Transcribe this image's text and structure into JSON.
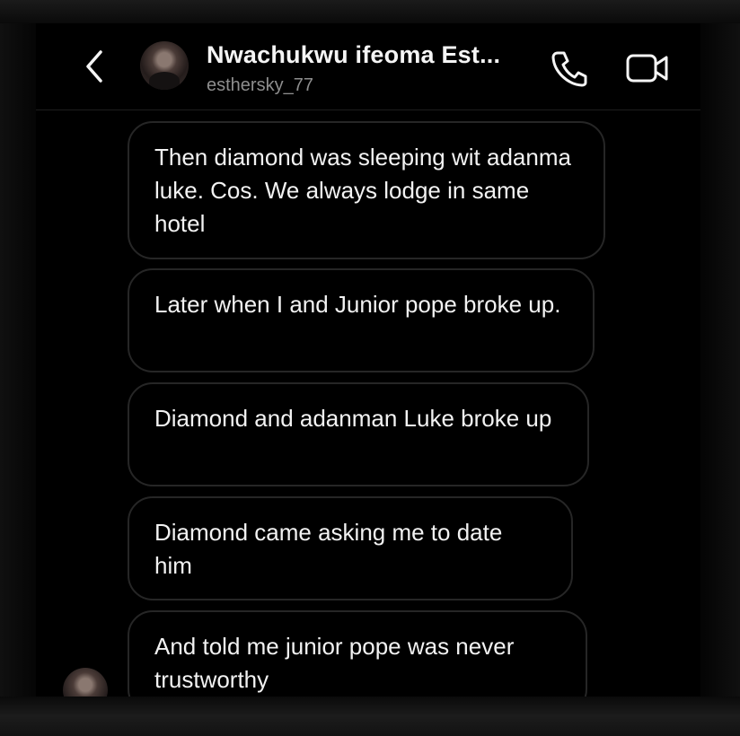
{
  "header": {
    "contact_name": "Nwachukwu ifeoma Est...",
    "username": "esthersky_77"
  },
  "icons": {
    "back": "chevron-left-icon",
    "call": "phone-icon",
    "video": "video-camera-icon"
  },
  "messages": [
    "Then diamond was sleeping wit adanma luke.  Cos. We always lodge in same hotel",
    "Later when I and Junior pope broke up.",
    "Diamond and adanman Luke broke up",
    "Diamond came asking me to date him",
    "And told me junior pope was never trustworthy"
  ],
  "colors": {
    "background": "#000000",
    "bubble_border": "#262626",
    "text": "#f2f2f2",
    "secondary_text": "#8e8e8e"
  }
}
